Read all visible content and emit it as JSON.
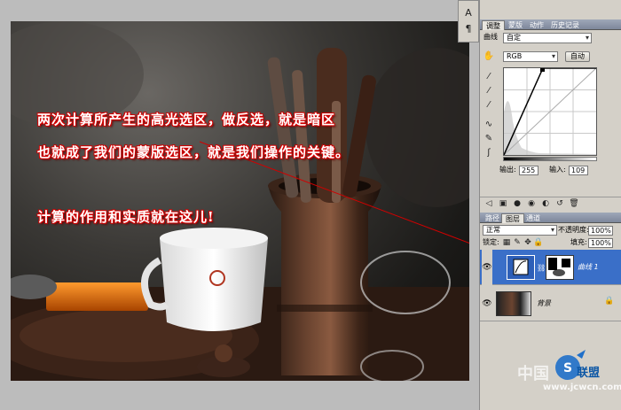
{
  "annotations": {
    "line1": "两次计算所产生的高光选区，做反选，就是暗区",
    "line2": "也就成了我们的蒙版选区，就是我们操作的关键。",
    "line3": "计算的作用和实质就在这儿!"
  },
  "watermarks": {
    "left": "中国",
    "url": "www.jcwcn.com",
    "brand": "联盟"
  },
  "tools": {
    "text_tool": "A",
    "paragraph_tool": "¶"
  },
  "adjust_panel": {
    "tabs": [
      "调整",
      "蒙版",
      "动作",
      "历史记录"
    ],
    "curves_label": "曲线",
    "preset_value": "自定",
    "channel_value": "RGB",
    "auto_button": "自动",
    "output_label": "输出:",
    "output_value": "255",
    "input_label": "输入:",
    "input_value": "109"
  },
  "layers_panel": {
    "tabs": [
      "路径",
      "图层",
      "通道"
    ],
    "blend_mode": "正常",
    "opacity_label": "不透明度:",
    "opacity_value": "100%",
    "lock_label": "锁定:",
    "fill_label": "填充:",
    "fill_value": "100%",
    "layers": [
      {
        "name": "曲线 1",
        "selected": true
      },
      {
        "name": "背景",
        "selected": false
      }
    ]
  },
  "colors": {
    "annotation_red": "#d10000",
    "selected_layer": "#3a6fc8",
    "panel_bg": "#d4d0c8"
  }
}
